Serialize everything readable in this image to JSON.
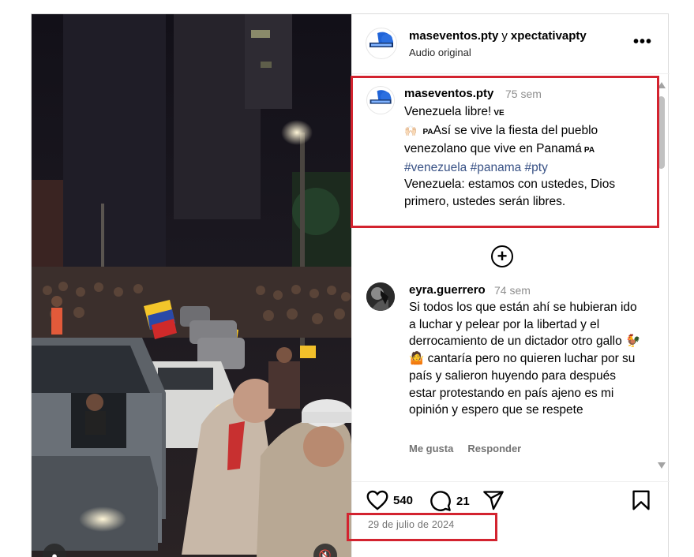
{
  "header": {
    "author": "maseventos.pty",
    "separator": "y",
    "coauthor": "xpectativapty",
    "audio": "Audio original",
    "more_label": "•••"
  },
  "caption": {
    "username": "maseventos.pty",
    "time": "75 sem",
    "line1": "Venezuela libre!",
    "flag1": "VE",
    "line2_emoji": "🙌🏻",
    "flag2": "PA",
    "line2": "Así se vive la fiesta del pueblo venezolano que vive en Panamá",
    "flag3": "PA",
    "hashtags": "#venezuela #panama #pty",
    "line3": "Venezuela: estamos con ustedes, Dios primero, ustedes serán libres."
  },
  "load_more_label": "+",
  "comment": {
    "username": "eyra.guerrero",
    "time": "74 sem",
    "text": "Si todos los que están ahí se hubieran ido a luchar y pelear por la libertad y el derrocamiento de un dictador otro gallo 🐓 🤷 cantaría pero no quieren luchar por su país y salieron huyendo para después estar protestando en país ajeno es mi opinión y espero que se respete",
    "like_label": "Me gusta",
    "reply_label": "Responder"
  },
  "actions": {
    "likes": "540",
    "comments": "21"
  },
  "date": "29 de julio de 2024",
  "icons": {
    "like": "heart-icon",
    "comment": "speech-bubble-icon",
    "share": "paper-plane-icon",
    "save": "bookmark-icon",
    "load_more": "plus-circle-icon",
    "more": "ellipsis-icon",
    "media_left": "info-icon",
    "media_right": "muted-speaker-icon"
  },
  "colors": {
    "highlight": "#d3232f",
    "hashtag": "#385185",
    "muted_text": "#8e8e8e"
  }
}
